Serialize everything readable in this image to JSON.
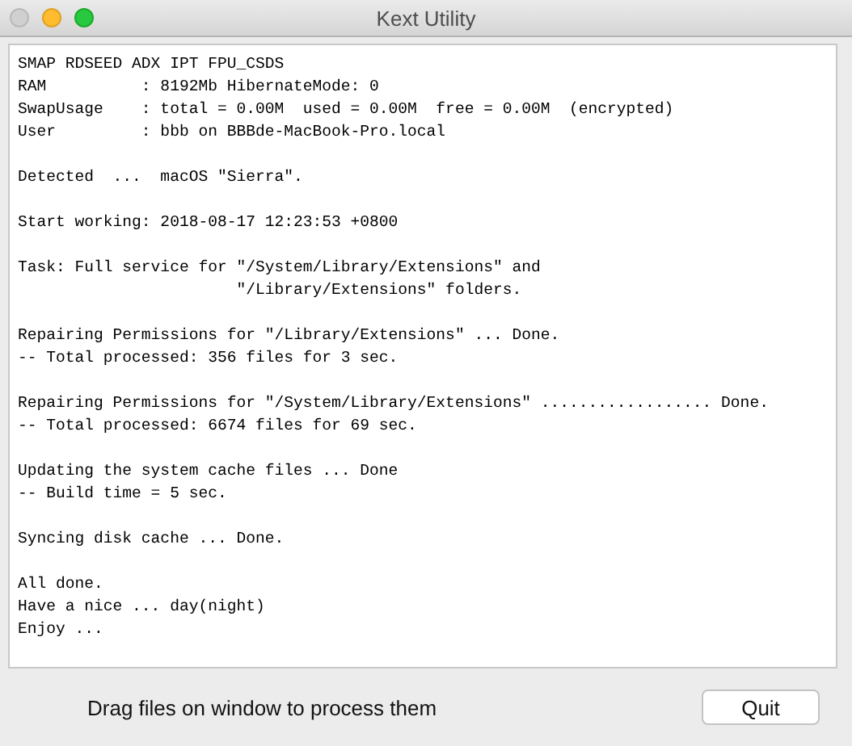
{
  "window": {
    "title": "Kext Utility",
    "buttons": [
      {
        "kind": "close",
        "disabled": true
      },
      {
        "kind": "minimize",
        "disabled": false
      },
      {
        "kind": "zoom",
        "disabled": false
      }
    ]
  },
  "log": {
    "sections": [
      {
        "blocks": [
          {
            "lines": [
              "SMAP RDSEED ADX IPT FPU_CSDS",
              "RAM          : 8192Mb HibernateMode: 0",
              "SwapUsage    : total = 0.00M  used = 0.00M  free = 0.00M  (encrypted)",
              "User         : bbb on BBBde-MacBook-Pro.local"
            ]
          },
          {
            "lines": [
              "Detected  ...  macOS \"Sierra\"."
            ]
          },
          {
            "lines": [
              "Start working: 2018-08-17 12:23:53 +0800"
            ]
          },
          {
            "lines": [
              "Task: Full service for \"/System/Library/Extensions\" and",
              "                       \"/Library/Extensions\" folders."
            ]
          },
          {
            "lines": [
              "Repairing Permissions for \"/Library/Extensions\" ... Done.",
              "-- Total processed: 356 files for 3 sec."
            ]
          },
          {
            "lines": [
              "Repairing Permissions for \"/System/Library/Extensions\" .................. Done.",
              "-- Total processed: 6674 files for 69 sec."
            ]
          },
          {
            "lines": [
              "Updating the system cache files ... Done",
              "-- Build time = 5 sec."
            ]
          }
        ]
      },
      {
        "blocks": [
          {
            "lines": [
              "Syncing disk cache ... Done."
            ]
          },
          {
            "lines": [
              "All done.",
              "Have a nice ... day(night)",
              "Enjoy ..."
            ]
          }
        ]
      }
    ]
  },
  "footer": {
    "hint": "Drag files on window to process them",
    "button": "Quit"
  }
}
